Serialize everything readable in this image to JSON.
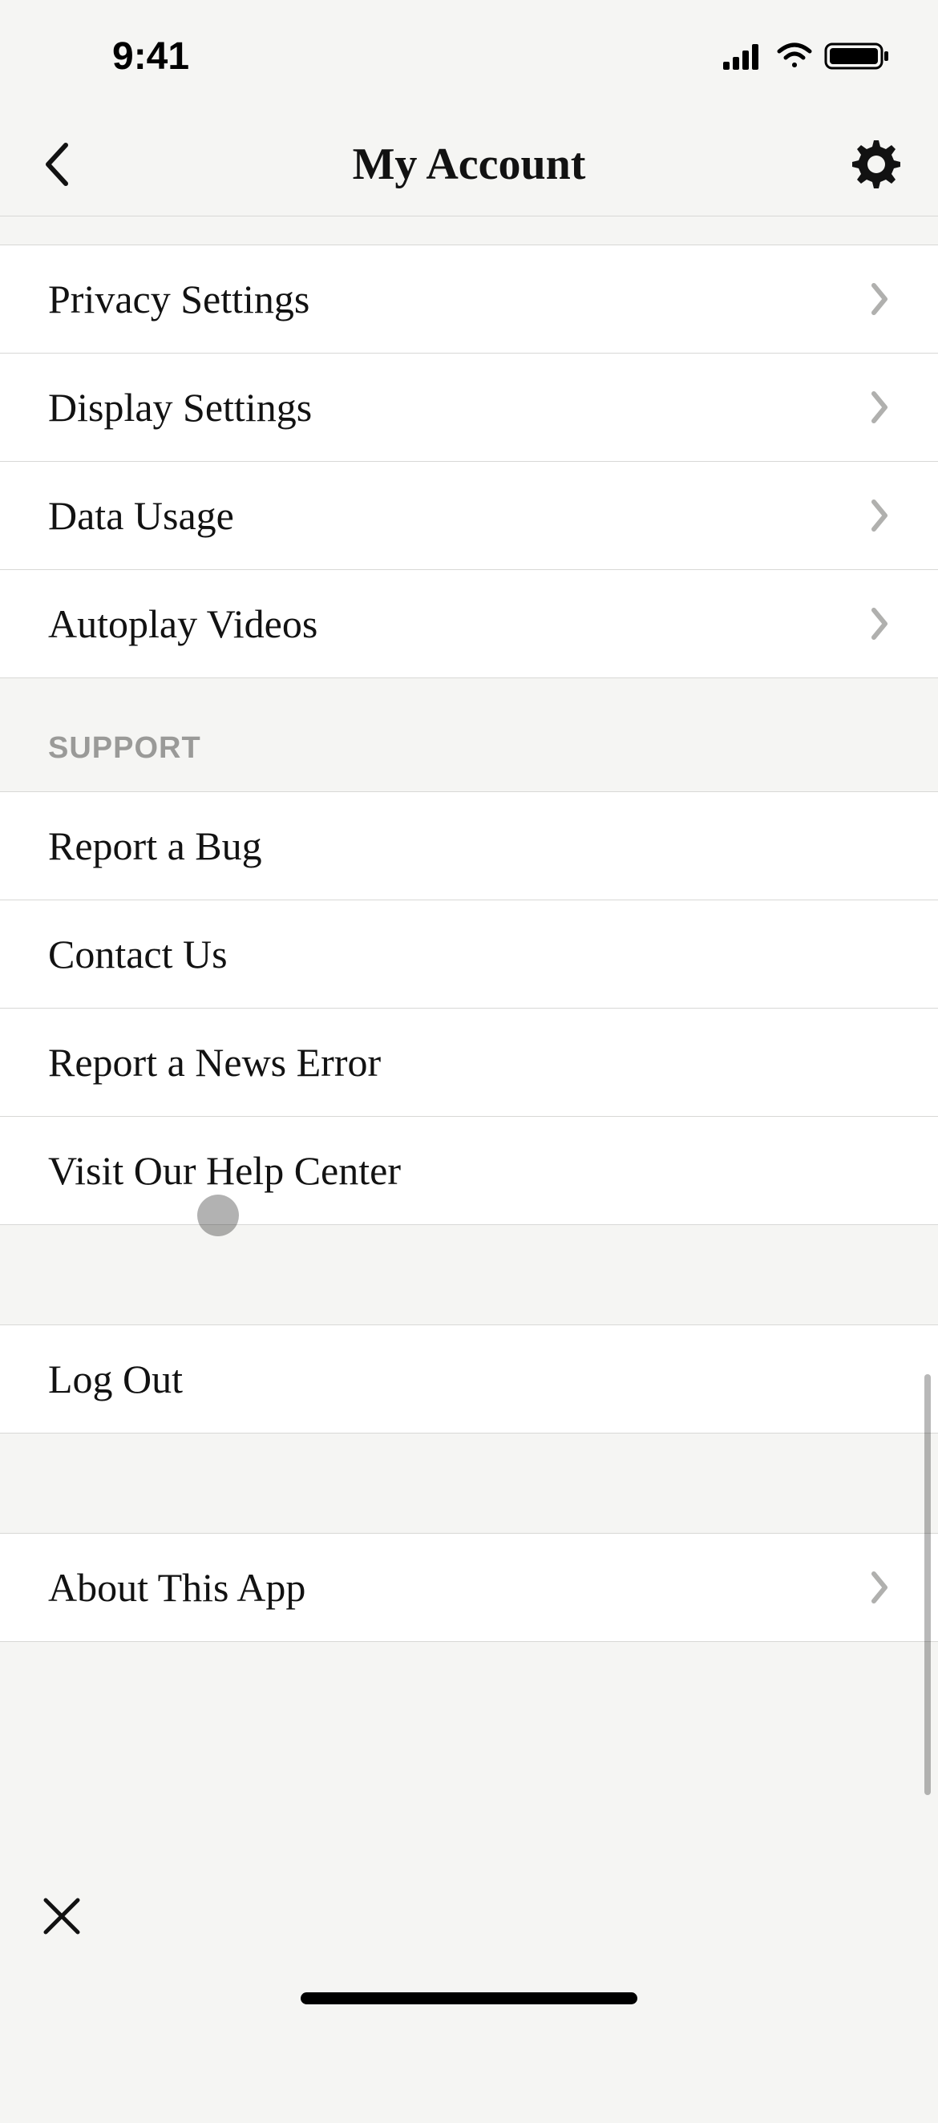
{
  "statusBar": {
    "time": "9:41"
  },
  "header": {
    "title": "My Account"
  },
  "settings": [
    {
      "label": "Privacy Settings",
      "name": "privacy-settings"
    },
    {
      "label": "Display Settings",
      "name": "display-settings"
    },
    {
      "label": "Data Usage",
      "name": "data-usage"
    },
    {
      "label": "Autoplay Videos",
      "name": "autoplay-videos"
    }
  ],
  "supportHeader": "SUPPORT",
  "supportItems": [
    {
      "label": "Report a Bug",
      "name": "report-a-bug"
    },
    {
      "label": "Contact Us",
      "name": "contact-us"
    },
    {
      "label": "Report a News Error",
      "name": "report-news-error"
    },
    {
      "label": "Visit Our Help Center",
      "name": "visit-help-center"
    }
  ],
  "logout": {
    "label": "Log Out"
  },
  "about": {
    "label": "About This App"
  }
}
